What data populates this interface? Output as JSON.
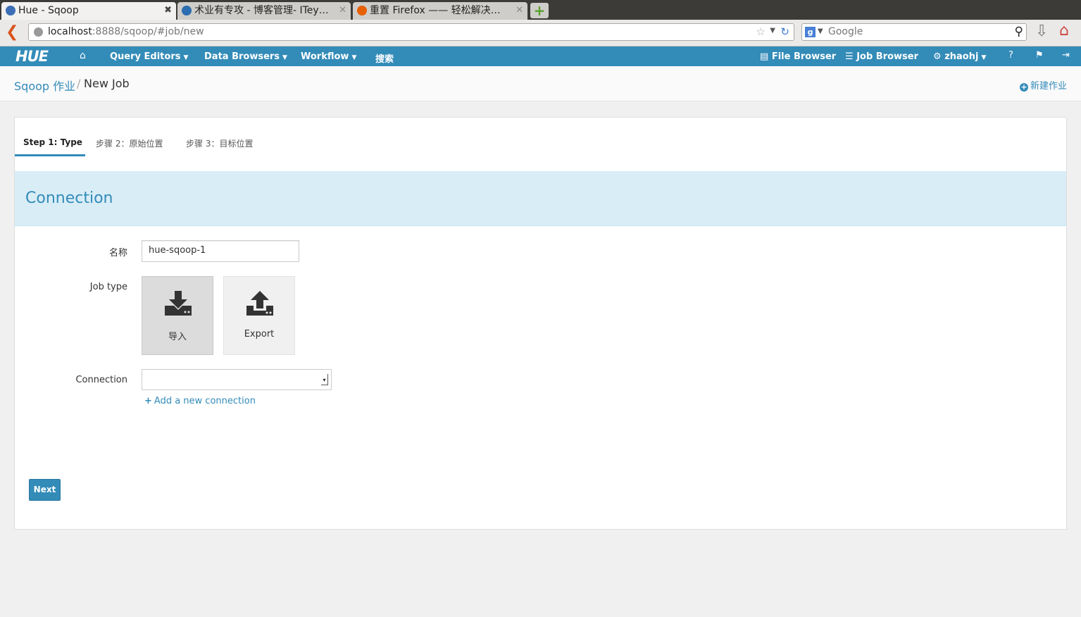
{
  "browser": {
    "tabs": [
      {
        "title": "Hue - Sqoop",
        "active": true,
        "favicon_color": "#3b6eb5"
      },
      {
        "title": "术业有专攻 - 博客管理- ITey…",
        "active": false,
        "favicon_color": "#2a6db0"
      },
      {
        "title": "重置 Firefox —— 轻松解决…",
        "active": false,
        "favicon_color": "#e66000"
      }
    ],
    "new_tab_icon": "plus-icon",
    "url_host": "localhost",
    "url_rest": ":8888/sqoop/#job/new",
    "search_placeholder": "Google"
  },
  "hue_nav": {
    "logo": "HUE",
    "home_icon": "home-icon",
    "menus": [
      "Query Editors",
      "Data Browsers",
      "Workflow"
    ],
    "search_label": "搜索",
    "file_browser": "File Browser",
    "job_browser": "Job Browser",
    "user": "zhaohj",
    "icons": [
      "help-icon",
      "flag-icon",
      "logout-icon"
    ]
  },
  "breadcrumb": {
    "parent": "Sqoop 作业",
    "separator": "/",
    "current": "New Job",
    "new_job_label": "新建作业"
  },
  "steps": [
    "Step 1: Type",
    "步骤 2：原始位置",
    "步骤 3：目标位置"
  ],
  "section_title": "Connection",
  "form": {
    "name_label": "名称",
    "name_value": "hue-sqoop-1",
    "job_type_label": "Job type",
    "job_types": [
      {
        "label": "导入",
        "icon": "download-icon",
        "selected": true
      },
      {
        "label": "Export",
        "icon": "upload-icon",
        "selected": false
      }
    ],
    "connection_label": "Connection",
    "connection_value": "",
    "add_connection": "Add a new connection"
  },
  "next_button": "Next",
  "colors": {
    "accent": "#338bb8",
    "section_bg": "#d9edf7",
    "page_bg": "#f0f0f0"
  }
}
